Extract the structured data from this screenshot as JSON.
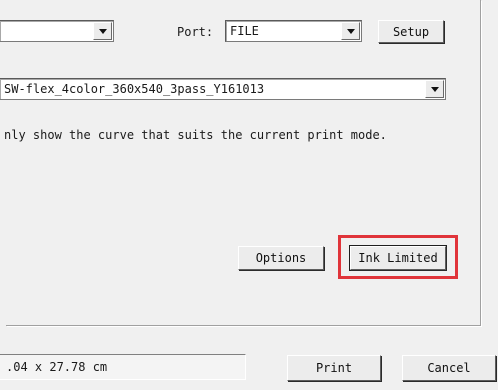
{
  "printer_row": {
    "printer_combo_value": "",
    "port_label": "Port:",
    "port_value": "FILE",
    "setup_label": "Setup"
  },
  "profile_combo": {
    "value": "SW-flex_4color_360x540_3pass_Y161013"
  },
  "hint_text": "nly show the curve that suits the current print mode.",
  "buttons": {
    "options": "Options",
    "ink_limited": "Ink Limited",
    "print": "Print",
    "cancel": "Cancel"
  },
  "status_bar": {
    "size_text": ".04 x 27.78 cm"
  },
  "highlight_color": "#e0343a"
}
